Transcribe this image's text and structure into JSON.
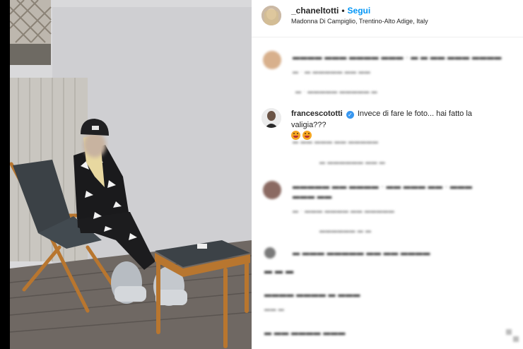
{
  "post": {
    "username": "_chaneltotti",
    "separator": "•",
    "follow_label": "Segui",
    "location": "Madonna Di Campiglio, Trentino-Alto Adige, Italy"
  },
  "comments": {
    "highlighted": {
      "username": "francescototti",
      "verified_mark": "✓",
      "text": "Invece di fare le foto... hai fatto la valigia???"
    },
    "blurred": [
      "▬▬▬▬ ▬▬▬ ▬▬▬▬ ▬▬▬ · ▬ ▬ ▬▬ ▬▬▬ ▬▬▬▬",
      "▬ · ▬ ▬▬▬▬▬ ▬▬ ▬▬",
      "▬ · ▬▬▬▬▬ ▬▬▬▬▬ ▬",
      "▬ ▬▬ ▬▬▬ ▬▬ ▬▬▬▬▬",
      "▬ ▬▬▬▬▬▬ ▬▬ ▬",
      "▬▬▬▬▬ ▬▬ ▬▬▬▬ · ▬▬ ▬▬▬ ▬▬ · ▬▬▬",
      "▬▬▬ ▬▬",
      "▬ · ▬▬▬ ▬▬▬▬ ▬▬ ▬▬▬▬▬",
      "▬▬▬▬▬▬ ▬ ▬",
      "▬ ▬▬▬ ▬▬▬▬▬ ▬▬ ▬▬ ▬▬▬▬",
      "▬ ▬ ▬",
      "▬▬▬▬ ▬▬▬▬ ▬ ▬▬▬",
      "▬▬ ▬",
      "▬ ▬▬ ▬▬▬▬ ▬▬▬"
    ]
  },
  "colors": {
    "follow": "#0095f6",
    "verified": "#3897f0",
    "photo_bg": "#dcdcdc"
  }
}
